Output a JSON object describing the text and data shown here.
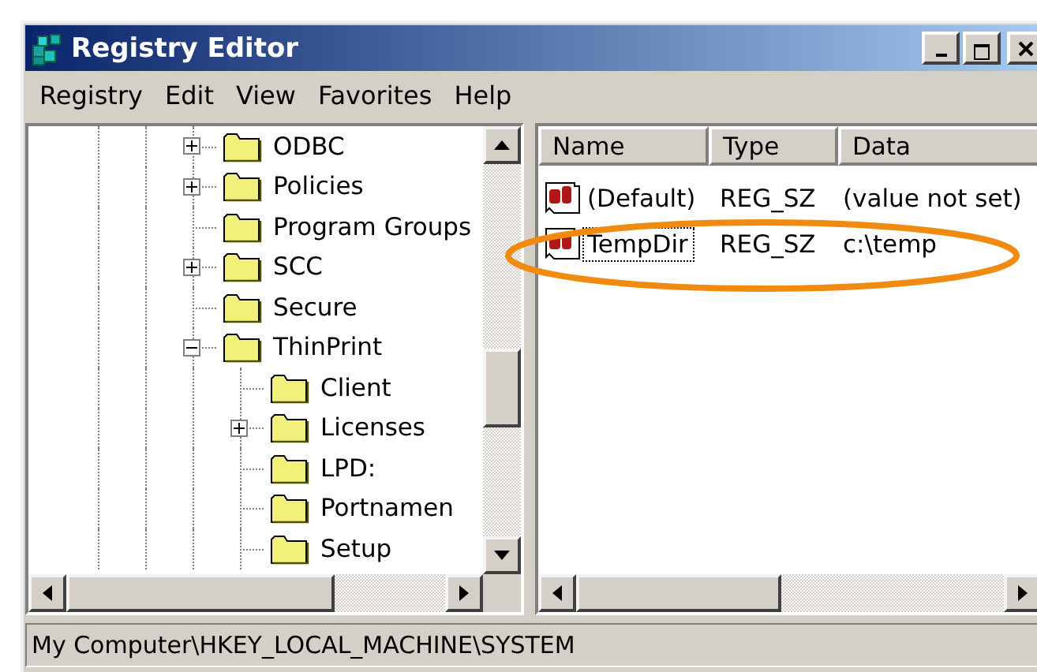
{
  "window": {
    "title": "Registry Editor"
  },
  "menu": [
    {
      "label": "Registry"
    },
    {
      "label": "Edit"
    },
    {
      "label": "View"
    },
    {
      "label": "Favorites"
    },
    {
      "label": "Help"
    }
  ],
  "tree": [
    {
      "label": "ODBC",
      "kind": "collapsed"
    },
    {
      "label": "Policies",
      "kind": "collapsed"
    },
    {
      "label": "Program Groups",
      "kind": "leaf"
    },
    {
      "label": "SCC",
      "kind": "collapsed"
    },
    {
      "label": "Secure",
      "kind": "leaf"
    },
    {
      "label": "ThinPrint",
      "kind": "expanded",
      "children": [
        {
          "label": "Client",
          "kind": "leaf"
        },
        {
          "label": "Licenses",
          "kind": "collapsed"
        },
        {
          "label": "LPD:",
          "kind": "leaf"
        },
        {
          "label": "Portnamen",
          "kind": "leaf"
        },
        {
          "label": "Setup",
          "kind": "leaf"
        }
      ]
    }
  ],
  "list": {
    "columns": [
      "Name",
      "Type",
      "Data"
    ],
    "rows": [
      {
        "name": "(Default)",
        "type": "REG_SZ",
        "data": "(value not set)",
        "selected": false
      },
      {
        "name": "TempDir",
        "type": "REG_SZ",
        "data": "c:\\temp",
        "selected": true
      }
    ]
  },
  "status_bar": "My Computer\\HKEY_LOCAL_MACHINE\\SYSTEM"
}
